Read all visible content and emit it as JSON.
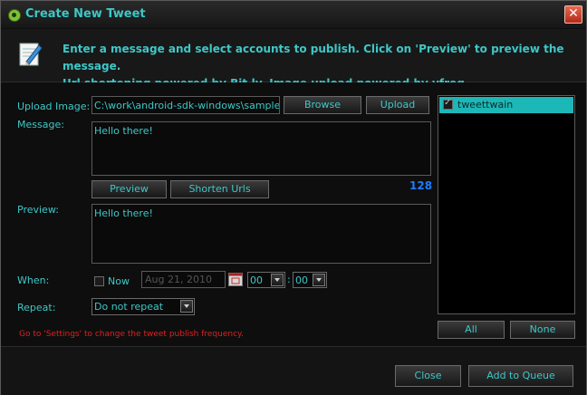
{
  "window": {
    "title": "Create New Tweet",
    "close_symbol": "✕"
  },
  "header": {
    "line1": "Enter a message and select accounts to publish. Click on 'Preview' to preview the message.",
    "line2": "Url shortening powered by Bit.ly. Image upload powered by yfrog."
  },
  "form": {
    "upload_image_label": "Upload Image:",
    "upload_image_value": "C:\\work\\android-sdk-windows\\samples\\andr",
    "browse_label": "Browse",
    "upload_label": "Upload",
    "message_label": "Message:",
    "message_value": "Hello there!",
    "preview_button_label": "Preview",
    "shorten_urls_label": "Shorten Urls",
    "char_counter": "128",
    "preview_label": "Preview:",
    "preview_value": "Hello there!",
    "when_label": "When:",
    "now_label": "Now",
    "now_checked": false,
    "date_value": "Aug 21, 2010",
    "hour_value": "00",
    "time_separator": ":",
    "minute_value": "00",
    "repeat_label": "Repeat:",
    "repeat_value": "Do not repeat",
    "hint_text": "Go to 'Settings' to change the tweet publish frequency."
  },
  "accounts": {
    "items": [
      {
        "label": "tweettwain",
        "checked": true
      }
    ],
    "all_label": "All",
    "none_label": "None"
  },
  "footer": {
    "close_label": "Close",
    "add_to_queue_label": "Add to Queue"
  },
  "colors": {
    "accent": "#3fc7c7",
    "counter": "#1c7cff",
    "hint": "#e02020",
    "selection": "#1cb7b7"
  },
  "icons": {
    "title": "app-logo-icon",
    "header": "compose-pencil-icon",
    "calendar": "calendar-icon"
  }
}
